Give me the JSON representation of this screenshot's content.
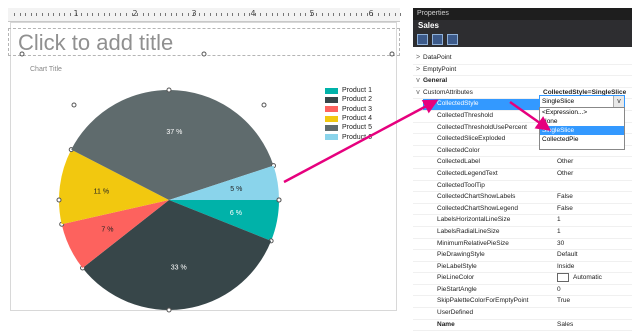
{
  "ruler": {
    "numbers": [
      "1",
      "2",
      "3",
      "4",
      "5",
      "6"
    ]
  },
  "slide": {
    "title_placeholder": "Click to add title",
    "chart_title": "Chart Title"
  },
  "chart_data": {
    "type": "pie",
    "categories": [
      "Product 1",
      "Product 2",
      "Product 3",
      "Product 4",
      "Product 5",
      "Product 6"
    ],
    "values": [
      6,
      33,
      7,
      11,
      37,
      5
    ],
    "labels": [
      "6 %",
      "33 %",
      "7 %",
      "11 %",
      "37 %",
      "5 %"
    ],
    "colors": [
      "#00b2a9",
      "#374649",
      "#fd625e",
      "#f2c80f",
      "#5f6b6d",
      "#8ad4eb"
    ],
    "legend": "right"
  },
  "props": {
    "window_title": "Properties",
    "object": "Sales",
    "rows": [
      {
        "exp": ">",
        "name": "DataPoint",
        "val": ""
      },
      {
        "exp": ">",
        "name": "EmptyPoint",
        "val": ""
      },
      {
        "exp": "v",
        "name": "General",
        "val": "",
        "cat": true
      },
      {
        "exp": "v",
        "name": "CustomAttributes",
        "val": "CollectedStyle=SingleSlice",
        "bold": true
      },
      {
        "exp": "",
        "name": "CollectedStyle",
        "val": "SingleSlice",
        "sel": true
      },
      {
        "exp": "",
        "name": "CollectedThreshold",
        "val": ""
      },
      {
        "exp": "",
        "name": "CollectedThresholdUsePercent",
        "val": ""
      },
      {
        "exp": "",
        "name": "CollectedSliceExploded",
        "val": ""
      },
      {
        "exp": "",
        "name": "CollectedColor",
        "val": ""
      },
      {
        "exp": "",
        "name": "CollectedLabel",
        "val": "Other"
      },
      {
        "exp": "",
        "name": "CollectedLegendText",
        "val": "Other"
      },
      {
        "exp": "",
        "name": "CollectedToolTip",
        "val": ""
      },
      {
        "exp": "",
        "name": "CollectedChartShowLabels",
        "val": "False"
      },
      {
        "exp": "",
        "name": "CollectedChartShowLegend",
        "val": "False"
      },
      {
        "exp": "",
        "name": "LabelsHorizontalLineSize",
        "val": "1"
      },
      {
        "exp": "",
        "name": "LabelsRadialLineSize",
        "val": "1"
      },
      {
        "exp": "",
        "name": "MinimumRelativePieSize",
        "val": "30"
      },
      {
        "exp": "",
        "name": "PieDrawingStyle",
        "val": "Default"
      },
      {
        "exp": "",
        "name": "PieLabelStyle",
        "val": "Inside"
      },
      {
        "exp": "",
        "name": "PieLineColor",
        "val": "Automatic",
        "color": true
      },
      {
        "exp": "",
        "name": "PieStartAngle",
        "val": "0"
      },
      {
        "exp": "",
        "name": "SkipPaletteColorForEmptyPoint",
        "val": "True"
      },
      {
        "exp": "",
        "name": "UserDefined",
        "val": ""
      },
      {
        "exp": "",
        "name": "Name",
        "val": "Sales",
        "cat": true
      }
    ],
    "dropdown": {
      "value": "SingleSlice",
      "button": "v",
      "options": [
        "<Expression...>",
        "None",
        "SingleSlice",
        "CollectedPie"
      ],
      "selected": 2
    }
  }
}
